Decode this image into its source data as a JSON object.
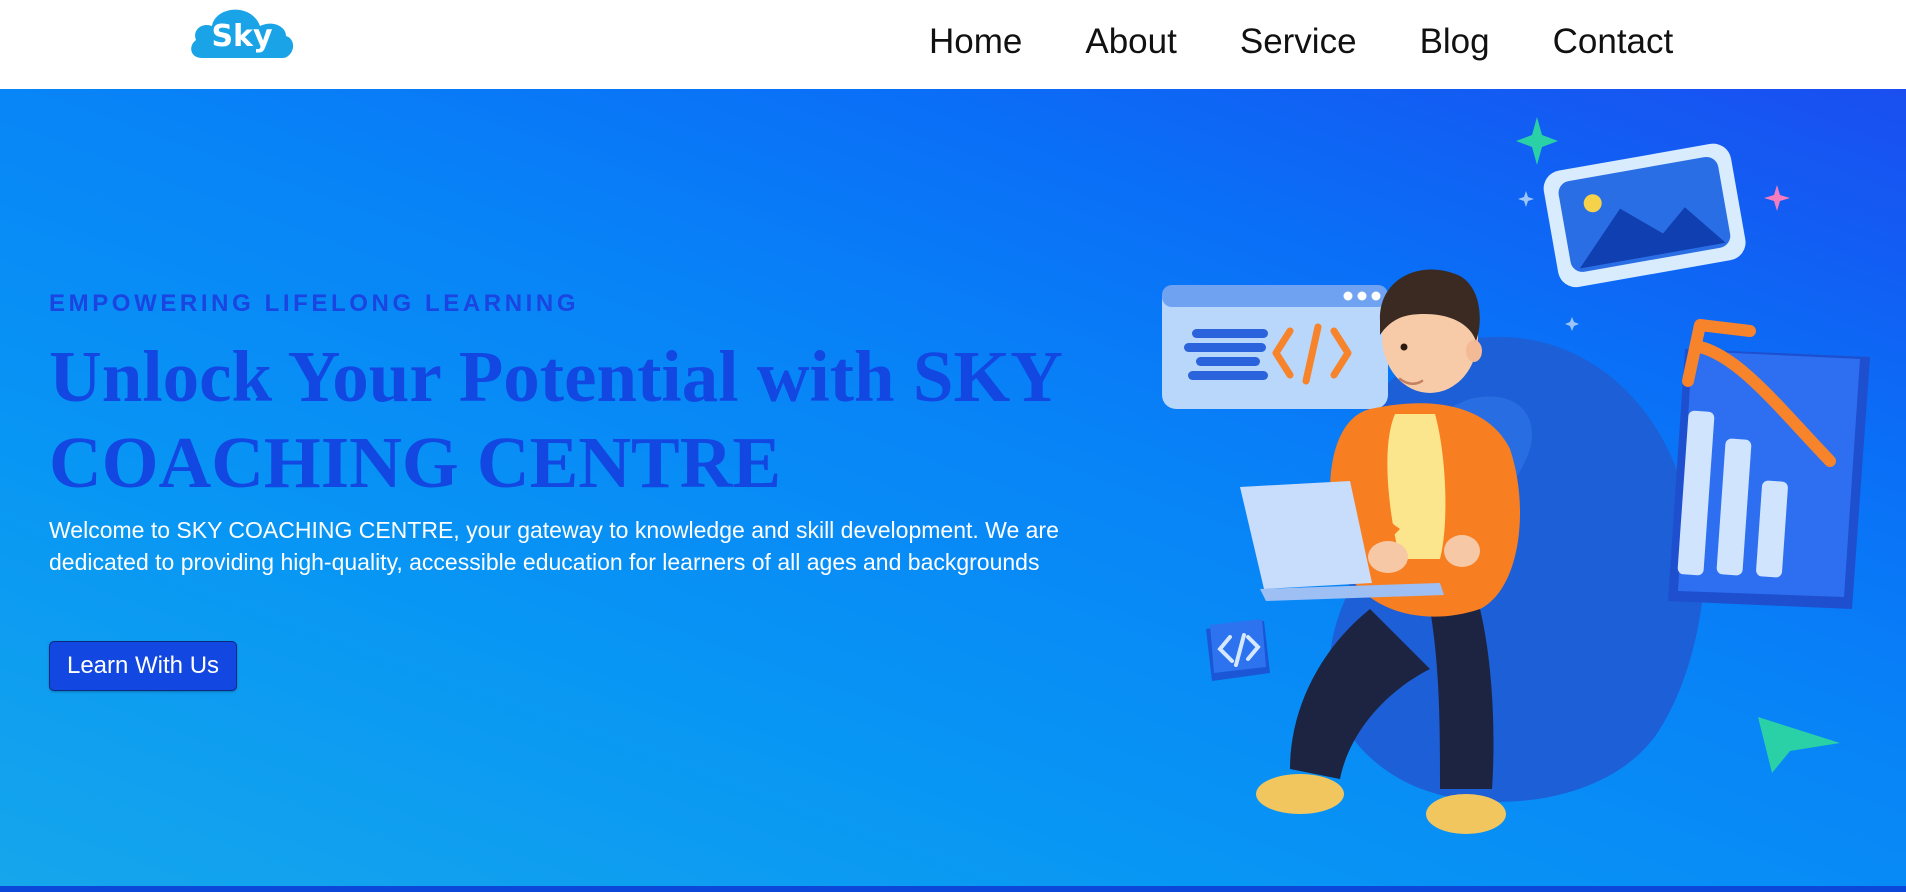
{
  "brand": {
    "logo_text": "Sky"
  },
  "nav": {
    "items": [
      {
        "label": "Home"
      },
      {
        "label": "About"
      },
      {
        "label": "Service"
      },
      {
        "label": "Blog"
      },
      {
        "label": "Contact"
      }
    ]
  },
  "hero": {
    "eyebrow": "EMPOWERING LIFELONG LEARNING",
    "headline": "Unlock Your Potential with SKY COACHING CENTRE",
    "description": "Welcome to SKY COACHING CENTRE, your gateway to knowledge and skill development. We are dedicated to providing high-quality, accessible education for learners of all ages and backgrounds",
    "cta_label": "Learn With Us",
    "illustration_icons": [
      "code-window-icon",
      "image-card-icon",
      "growth-chart-icon",
      "code-badge-icon",
      "paper-plane-icon",
      "sparkle-icon"
    ]
  },
  "colors": {
    "brand_blue": "#1aa3e6",
    "accent_blue": "#1247e2",
    "hero_gradient_start": "#15a6ec",
    "hero_gradient_end": "#1a4ef0",
    "text_white": "#ffffff",
    "nav_text": "#111111"
  }
}
